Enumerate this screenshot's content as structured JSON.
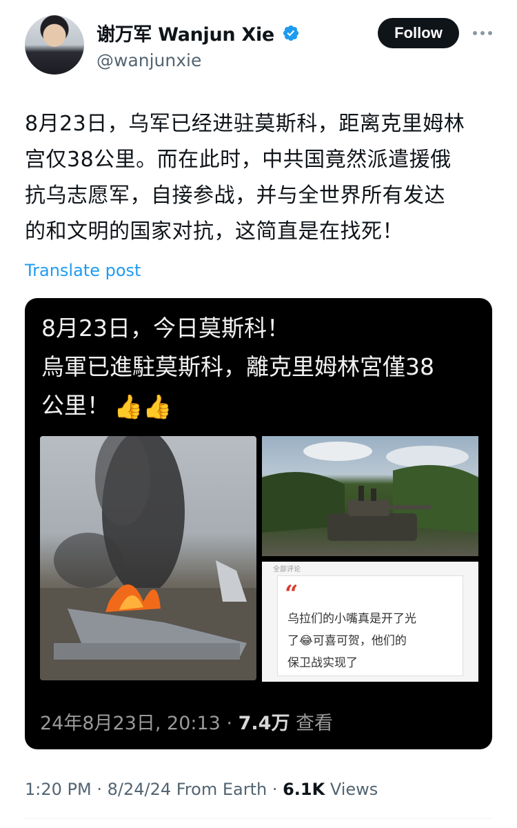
{
  "author": {
    "display_name": "谢万军 Wanjun Xie",
    "handle": "@wanjunxie",
    "avatar": "avatar-photo",
    "verified_icon": "verified-badge-icon"
  },
  "actions": {
    "follow_label": "Follow",
    "more_icon": "more-horizontal-icon"
  },
  "tweet": {
    "text_lines": [
      "8月23日，乌军已经进驻莫斯科，距离克里姆林",
      "宫仅38公里。而在此时，中共国竟然派遣援俄",
      "抗乌志愿军，自接参战，并与全世界所有发达",
      "的和文明的国家对抗，这简直是在找死！"
    ],
    "translate_label": "Translate post"
  },
  "media": {
    "header_lines": [
      "8月23日，今日莫斯科！",
      "烏軍已進駐莫斯科，離克里姆林宮僅38",
      "公里！"
    ],
    "emoji": "👍👍",
    "quote_card": {
      "top_text": "全部评论",
      "mark": "“",
      "lines": [
        "乌拉们的小嘴真是开了光",
        "了😂可喜可贺，他们的",
        "保卫战实现了"
      ]
    },
    "footer_date": "24年8月23日, 20:13 · ",
    "footer_views": "7.4万",
    "footer_suffix": " 查看"
  },
  "meta": {
    "time_date": "1:20 PM · 8/24/24 From Earth · ",
    "views_count": "6.1K",
    "views_label": " Views"
  },
  "colors": {
    "link": "#1d9bf0",
    "text": "#0f1419",
    "muted": "#536471",
    "verified": "#1d9bf0"
  }
}
